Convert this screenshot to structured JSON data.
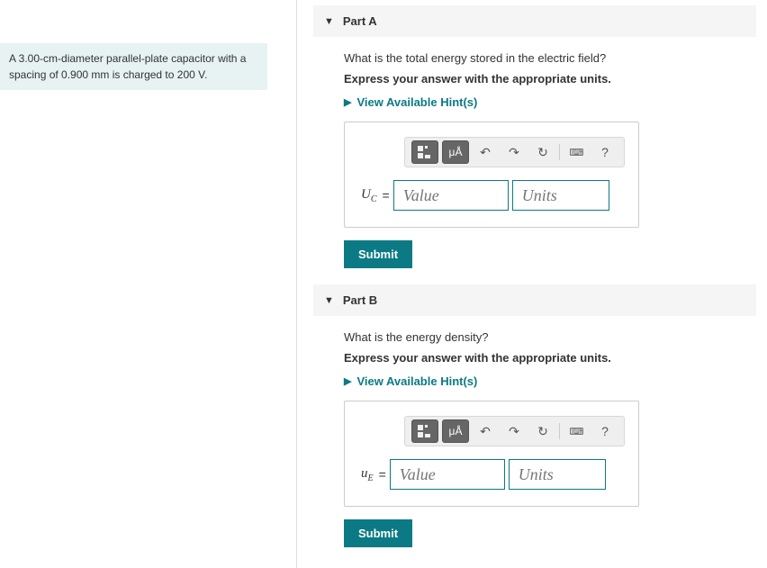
{
  "problem": {
    "text": "A 3.00-cm-diameter parallel-plate capacitor with a spacing of 0.900 mm is charged to 200 V."
  },
  "parts": [
    {
      "title": "Part A",
      "question": "What is the total energy stored in the electric field?",
      "instruction": "Express your answer with the appropriate units.",
      "hints_label": "View Available Hint(s)",
      "variable_html": "U<sub>C</sub>",
      "value_placeholder": "Value",
      "units_placeholder": "Units",
      "submit_label": "Submit"
    },
    {
      "title": "Part B",
      "question": "What is the energy density?",
      "instruction": "Express your answer with the appropriate units.",
      "hints_label": "View Available Hint(s)",
      "variable_html": "u<sub>E</sub>",
      "value_placeholder": "Value",
      "units_placeholder": "Units",
      "submit_label": "Submit"
    }
  ],
  "toolbar": {
    "units_btn": "μÅ",
    "help": "?"
  }
}
